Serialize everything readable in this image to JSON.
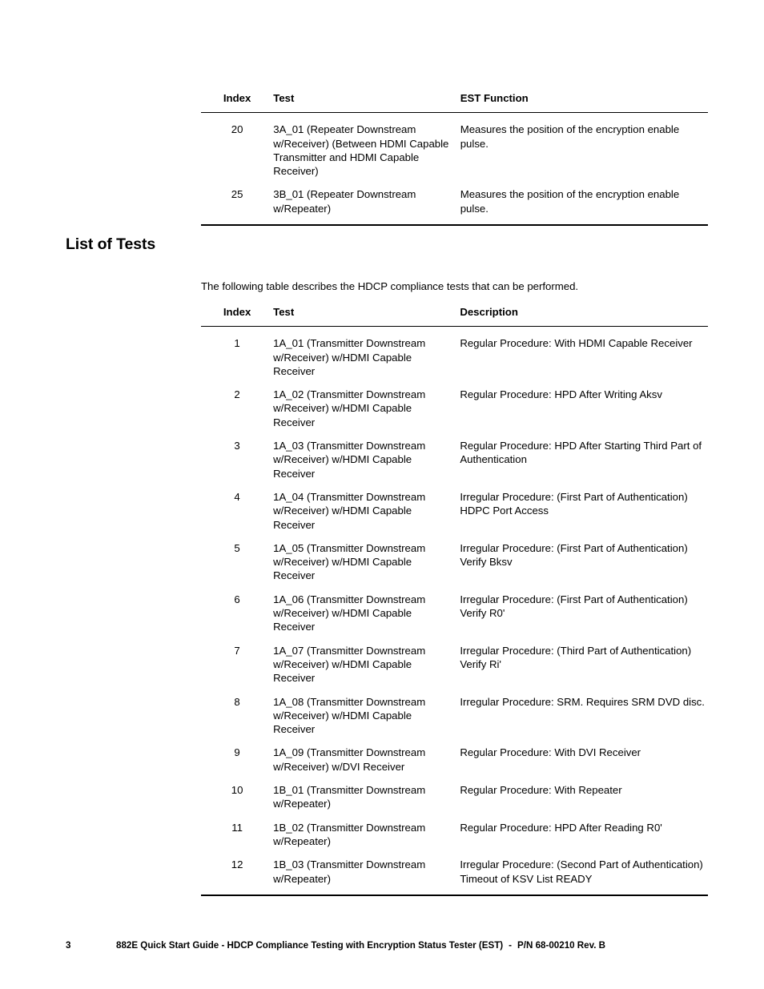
{
  "est_table": {
    "name": "est-function-table",
    "headers": {
      "index": "Index",
      "test": "Test",
      "function": "EST Function"
    },
    "rows": [
      {
        "index": "20",
        "test": "3A_01 (Repeater Downstream w/Receiver) (Between HDMI Capable Transmitter and HDMI Capable Receiver)",
        "function": "Measures the position of the encryption enable pulse."
      },
      {
        "index": "25",
        "test": "3B_01 (Repeater Downstream w/Repeater)",
        "function": "Measures the position of the encryption enable pulse."
      }
    ]
  },
  "section": {
    "heading": "List of Tests",
    "intro": "The following table describes the HDCP compliance tests that can be performed."
  },
  "tests_table": {
    "name": "list-of-tests-table",
    "headers": {
      "index": "Index",
      "test": "Test",
      "description": "Description"
    },
    "rows": [
      {
        "index": "1",
        "test": "1A_01 (Transmitter Downstream w/Receiver) w/HDMI Capable Receiver",
        "description": "Regular Procedure: With HDMI Capable Receiver"
      },
      {
        "index": "2",
        "test": "1A_02 (Transmitter Downstream w/Receiver) w/HDMI Capable Receiver",
        "description": "Regular Procedure: HPD After Writing Aksv"
      },
      {
        "index": "3",
        "test": "1A_03 (Transmitter Downstream w/Receiver) w/HDMI Capable Receiver",
        "description": "Regular Procedure: HPD After Starting Third Part of Authentication"
      },
      {
        "index": "4",
        "test": "1A_04 (Transmitter Downstream w/Receiver) w/HDMI Capable Receiver",
        "description": "Irregular Procedure: (First Part of Authentication) HDPC Port Access"
      },
      {
        "index": "5",
        "test": "1A_05 (Transmitter Downstream w/Receiver) w/HDMI Capable Receiver",
        "description": "Irregular Procedure: (First Part of Authentication) Verify Bksv"
      },
      {
        "index": "6",
        "test": "1A_06 (Transmitter Downstream w/Receiver) w/HDMI Capable Receiver",
        "description": "Irregular Procedure: (First Part of Authentication) Verify R0'"
      },
      {
        "index": "7",
        "test": "1A_07 (Transmitter Downstream w/Receiver) w/HDMI Capable Receiver",
        "description": "Irregular Procedure: (Third Part of Authentication) Verify Ri'"
      },
      {
        "index": "8",
        "test": "1A_08 (Transmitter Downstream w/Receiver) w/HDMI Capable Receiver",
        "description": "Irregular Procedure: SRM. Requires SRM DVD disc."
      },
      {
        "index": "9",
        "test": "1A_09 (Transmitter Downstream w/Receiver) w/DVI Receiver",
        "description": "Regular Procedure: With DVI Receiver"
      },
      {
        "index": "10",
        "test": "1B_01 (Transmitter Downstream w/Repeater)",
        "description": "Regular Procedure: With Repeater"
      },
      {
        "index": "11",
        "test": "1B_02 (Transmitter Downstream w/Repeater)",
        "description": "Regular Procedure: HPD After Reading R0'"
      },
      {
        "index": "12",
        "test": "1B_03 (Transmitter Downstream w/Repeater)",
        "description": "Irregular Procedure: (Second Part of Authentication) Timeout of KSV List READY"
      }
    ]
  },
  "footer": {
    "page_number": "3",
    "title": "882E Quick Start Guide - HDCP Compliance Testing with Encryption Status Tester (EST)",
    "separator": "-",
    "part_number": "P/N 68-00210 Rev. B"
  }
}
